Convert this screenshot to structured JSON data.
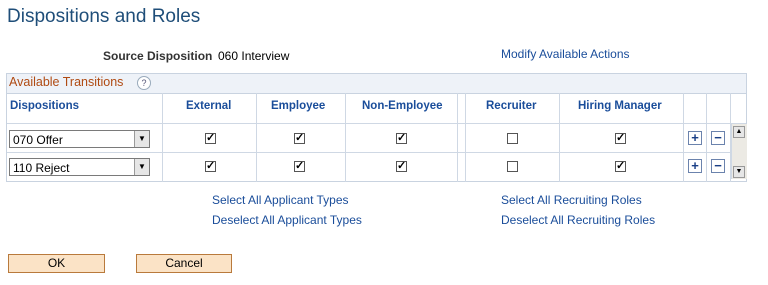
{
  "page": {
    "title": "Dispositions and Roles",
    "source_disposition_label": "Source Disposition",
    "source_disposition_value": "060 Interview",
    "modify_link": "Modify Available Actions"
  },
  "grid": {
    "title": "Available Transitions",
    "help_icon": "?",
    "columns": {
      "dispositions": "Dispositions",
      "external": "External",
      "employee": "Employee",
      "non_employee": "Non-Employee",
      "recruiter": "Recruiter",
      "hiring_manager": "Hiring Manager"
    },
    "rows": [
      {
        "disposition": "070 Offer",
        "external": true,
        "employee": true,
        "non_employee": true,
        "recruiter": false,
        "hiring_manager": true
      },
      {
        "disposition": "110 Reject",
        "external": true,
        "employee": true,
        "non_employee": true,
        "recruiter": false,
        "hiring_manager": true
      }
    ],
    "add_icon": "+",
    "remove_icon": "−",
    "dropdown_icon": "▼"
  },
  "links": {
    "select_all_applicant": "Select All Applicant Types",
    "deselect_all_applicant": "Deselect All Applicant Types",
    "select_all_recruiting": "Select All Recruiting Roles",
    "deselect_all_recruiting": "Deselect All Recruiting Roles"
  },
  "buttons": {
    "ok": "OK",
    "cancel": "Cancel"
  }
}
